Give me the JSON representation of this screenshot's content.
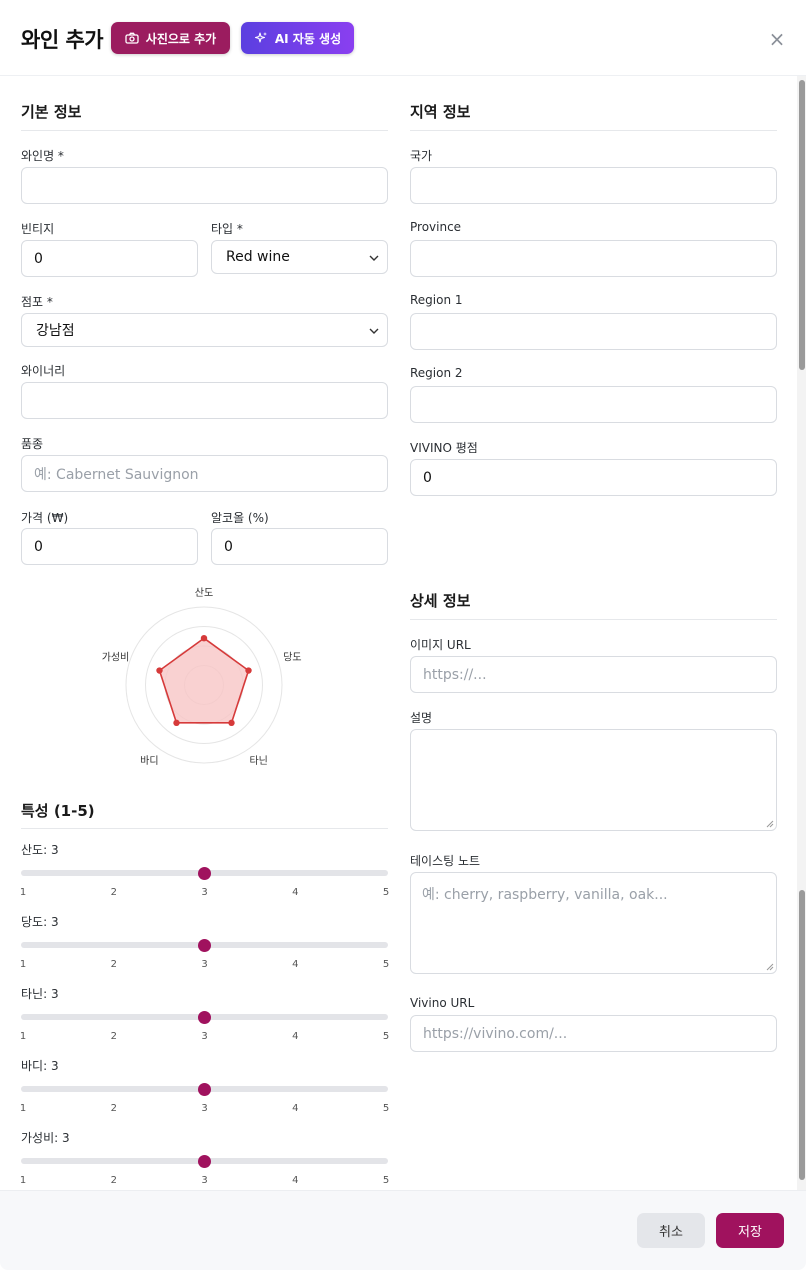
{
  "header": {
    "title": "와인 추가",
    "photo_button": "사진으로 추가",
    "ai_button": "AI 자동 생성",
    "close_glyph": "×"
  },
  "basic": {
    "section_title": "기본 정보",
    "wine_name_label": "와인명 *",
    "wine_name_value": "",
    "vintage_label": "빈티지",
    "vintage_value": "0",
    "type_label": "타입 *",
    "type_value": "Red wine",
    "store_label": "점포 *",
    "store_value": "강남점",
    "winery_label": "와이너리",
    "winery_value": "",
    "grape_label": "품종",
    "grape_placeholder": "예: Cabernet Sauvignon",
    "price_label": "가격 (₩)",
    "price_value": "0",
    "alcohol_label": "알코올 (%)",
    "alcohol_value": "0"
  },
  "region": {
    "section_title": "지역 정보",
    "country_label": "국가",
    "country_value": "",
    "province_label": "Province",
    "province_value": "",
    "region1_label": "Region 1",
    "region1_value": "",
    "region2_label": "Region 2",
    "region2_value": "",
    "vivino_rating_label": "VIVINO 평점",
    "vivino_rating_value": "0"
  },
  "detail": {
    "section_title": "상세 정보",
    "image_url_label": "이미지 URL",
    "image_url_placeholder": "https://...",
    "description_label": "설명",
    "description_value": "",
    "tasting_label": "테이스팅 노트",
    "tasting_placeholder": "예: cherry, raspberry, vanilla, oak...",
    "vivino_url_label": "Vivino URL",
    "vivino_url_placeholder": "https://vivino.com/..."
  },
  "radar": {
    "axes": [
      "산도",
      "당도",
      "타닌",
      "바디",
      "가성비"
    ],
    "values": [
      3,
      3,
      3,
      3,
      3
    ],
    "max": 5,
    "fill_color": "#f8c5c5",
    "stroke_color": "#d63a3a"
  },
  "traits": {
    "section_title": "특성 (1-5)",
    "ticks": [
      "1",
      "2",
      "3",
      "4",
      "5"
    ],
    "items": [
      {
        "label": "산도: 3",
        "value": 3
      },
      {
        "label": "당도: 3",
        "value": 3
      },
      {
        "label": "타닌: 3",
        "value": 3
      },
      {
        "label": "바디: 3",
        "value": 3
      },
      {
        "label": "가성비: 3",
        "value": 3
      }
    ]
  },
  "footer": {
    "cancel_label": "취소",
    "save_label": "저장"
  },
  "colors": {
    "primary": "#a0125e",
    "ai_gradient_start": "#5b3fe0",
    "ai_gradient_end": "#8a3ff0"
  }
}
